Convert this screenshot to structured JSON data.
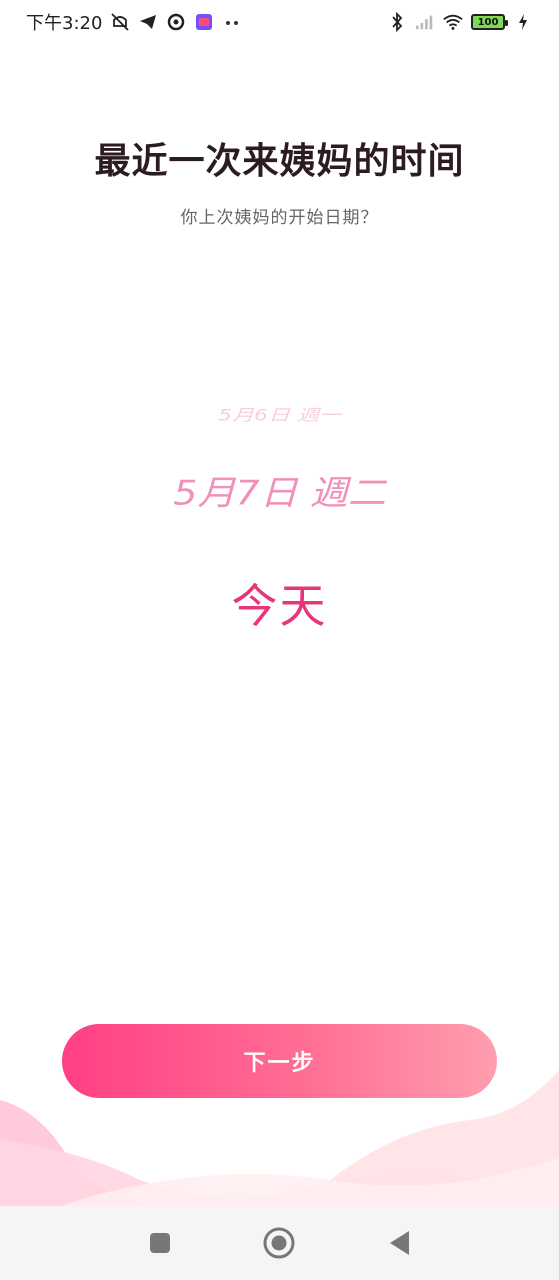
{
  "status_bar": {
    "time": "下午3:20",
    "icons_left": [
      "mute-icon",
      "telegram-icon",
      "sync-icon",
      "app-icon",
      "more-dots-icon"
    ],
    "icons_right": [
      "bluetooth-icon",
      "signal-icon",
      "wifi-icon",
      "battery-icon",
      "charging-icon"
    ],
    "battery_level": "100"
  },
  "header": {
    "title": "最近一次来姨妈的时间",
    "subtitle": "你上次姨妈的开始日期？"
  },
  "picker": {
    "items": [
      "5月6日 週一",
      "5月7日 週二",
      "今天"
    ],
    "selected_index": 2,
    "accent_color": "#e8347a"
  },
  "actions": {
    "next_label": "下一步"
  },
  "navigation": {
    "buttons": [
      "recent-apps",
      "home",
      "back"
    ]
  }
}
